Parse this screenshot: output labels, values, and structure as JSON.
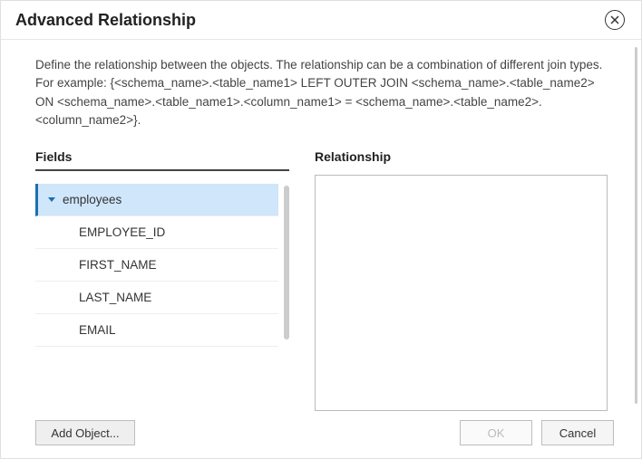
{
  "dialog": {
    "title": "Advanced Relationship",
    "description_line1": "Define the relationship between the objects. The relationship can be a combination of different join types.",
    "description_line2": "For example: {<schema_name>.<table_name1> LEFT OUTER JOIN <schema_name>.<table_name2> ON <schema_name>.<table_name1>.<column_name1> = <schema_name>.<table_name2>.<column_name2>}."
  },
  "fields": {
    "header": "Fields",
    "tree": {
      "parent": "employees",
      "children": [
        "EMPLOYEE_ID",
        "FIRST_NAME",
        "LAST_NAME",
        "EMAIL"
      ]
    }
  },
  "relationship": {
    "header": "Relationship",
    "value": ""
  },
  "buttons": {
    "add_object": "Add Object...",
    "ok": "OK",
    "cancel": "Cancel"
  }
}
